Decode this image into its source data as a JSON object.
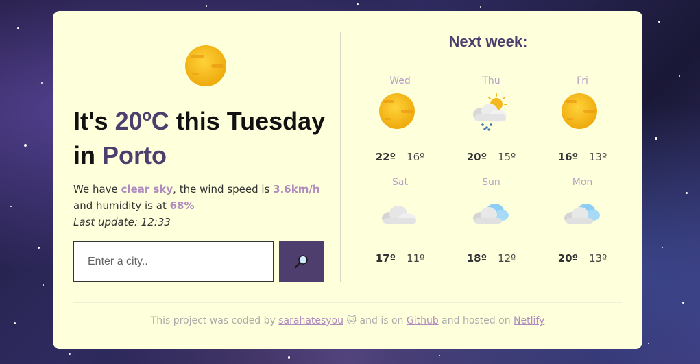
{
  "current": {
    "headline_prefix": "It's ",
    "temperature": "20ºC",
    "headline_mid": " this Tuesday",
    "headline_in": "in ",
    "city": "Porto",
    "icon": "sun-icon",
    "desc_prefix": "We have ",
    "condition": "clear sky",
    "desc_wind": ", the wind speed is ",
    "wind": "3.6km/h",
    "desc_humidity": " and humidity is at ",
    "humidity": "68%",
    "last_update": "Last update: 12:33"
  },
  "search": {
    "placeholder": "Enter a city..",
    "button_icon": "magnifier-icon"
  },
  "forecast": {
    "title": "Next week:",
    "days": [
      {
        "name": "Wed",
        "max": "22º",
        "min": "16º",
        "icon": "sun-icon"
      },
      {
        "name": "Thu",
        "max": "20º",
        "min": "15º",
        "icon": "rain-cloud-sun-icon"
      },
      {
        "name": "Fri",
        "max": "16º",
        "min": "13º",
        "icon": "sun-icon"
      },
      {
        "name": "Sat",
        "max": "17º",
        "min": "11º",
        "icon": "cloud-icon"
      },
      {
        "name": "Sun",
        "max": "18º",
        "min": "12º",
        "icon": "cloud-blue-icon"
      },
      {
        "name": "Mon",
        "max": "20º",
        "min": "13º",
        "icon": "cloud-blue-icon"
      }
    ]
  },
  "footer": {
    "part1": "This project was coded by ",
    "author": "sarahatesyou",
    "emoji": "🐱",
    "part2": " and is on ",
    "github": "Github",
    "part3": " and hosted on ",
    "netlify": "Netlify"
  },
  "colors": {
    "accent": "#4e3e6e",
    "highlight": "#b08bbf",
    "card": "#feffdb"
  }
}
